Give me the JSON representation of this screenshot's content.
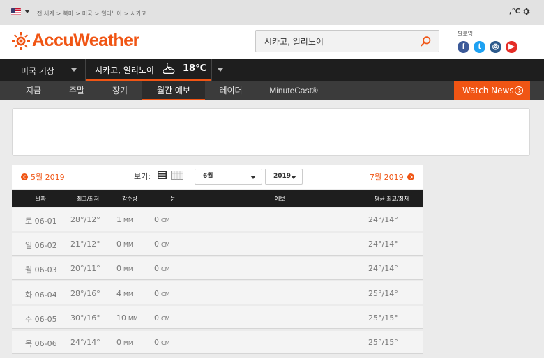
{
  "utility": {
    "breadcrumb": [
      "전 세계",
      "북미",
      "미국",
      "일리노이",
      "시카고"
    ],
    "unit_toggle": ",°C"
  },
  "header": {
    "brand": "AccuWeather",
    "search_value": "시카고, 일리노이",
    "follow_label": "팔로잉",
    "social": [
      {
        "icon": "facebook-icon",
        "glyph": "f",
        "color": "#3b5998"
      },
      {
        "icon": "twitter-icon",
        "glyph": "t",
        "color": "#1da1f2"
      },
      {
        "icon": "instagram-icon",
        "glyph": "◎",
        "color": "#2c5a8c"
      },
      {
        "icon": "youtube-icon",
        "glyph": "▶",
        "color": "#e52d27"
      }
    ]
  },
  "location": {
    "country": "미국 기상",
    "city": "시카고, 일리노이",
    "temp": "18°C"
  },
  "subnav": {
    "tabs": [
      "지금",
      "주말",
      "장기",
      "월간 예보",
      "레이더",
      "MinuteCast®"
    ],
    "active": "월간 예보",
    "watch_news": "Watch News"
  },
  "month_controls": {
    "prev": "5월 2019",
    "next": "7월 2019",
    "view_label": "보기:",
    "month_value": "6월",
    "year_value": "2019"
  },
  "table": {
    "headers": [
      "날짜",
      "최고/최저",
      "강수량",
      "눈",
      "예보",
      "평균 최고/최저"
    ],
    "rows": [
      {
        "day": "토",
        "date": "06-01",
        "hilo": "28°/12°",
        "precip": "1",
        "precip_unit": "MM",
        "snow": "0",
        "snow_unit": "CM",
        "avg": "24°/14°"
      },
      {
        "day": "일",
        "date": "06-02",
        "hilo": "21°/12°",
        "precip": "0",
        "precip_unit": "MM",
        "snow": "0",
        "snow_unit": "CM",
        "avg": "24°/14°"
      },
      {
        "day": "월",
        "date": "06-03",
        "hilo": "20°/11°",
        "precip": "0",
        "precip_unit": "MM",
        "snow": "0",
        "snow_unit": "CM",
        "avg": "24°/14°"
      },
      {
        "day": "화",
        "date": "06-04",
        "hilo": "28°/16°",
        "precip": "4",
        "precip_unit": "MM",
        "snow": "0",
        "snow_unit": "CM",
        "avg": "25°/14°"
      },
      {
        "day": "수",
        "date": "06-05",
        "hilo": "30°/16°",
        "precip": "10",
        "precip_unit": "MM",
        "snow": "0",
        "snow_unit": "CM",
        "avg": "25°/15°"
      },
      {
        "day": "목",
        "date": "06-06",
        "hilo": "24°/14°",
        "precip": "0",
        "precip_unit": "MM",
        "snow": "0",
        "snow_unit": "CM",
        "avg": "25°/15°"
      }
    ]
  },
  "colors": {
    "accent": "#f05514",
    "dark_bar": "#1e1e1e",
    "subnav": "#3b3b3b"
  }
}
